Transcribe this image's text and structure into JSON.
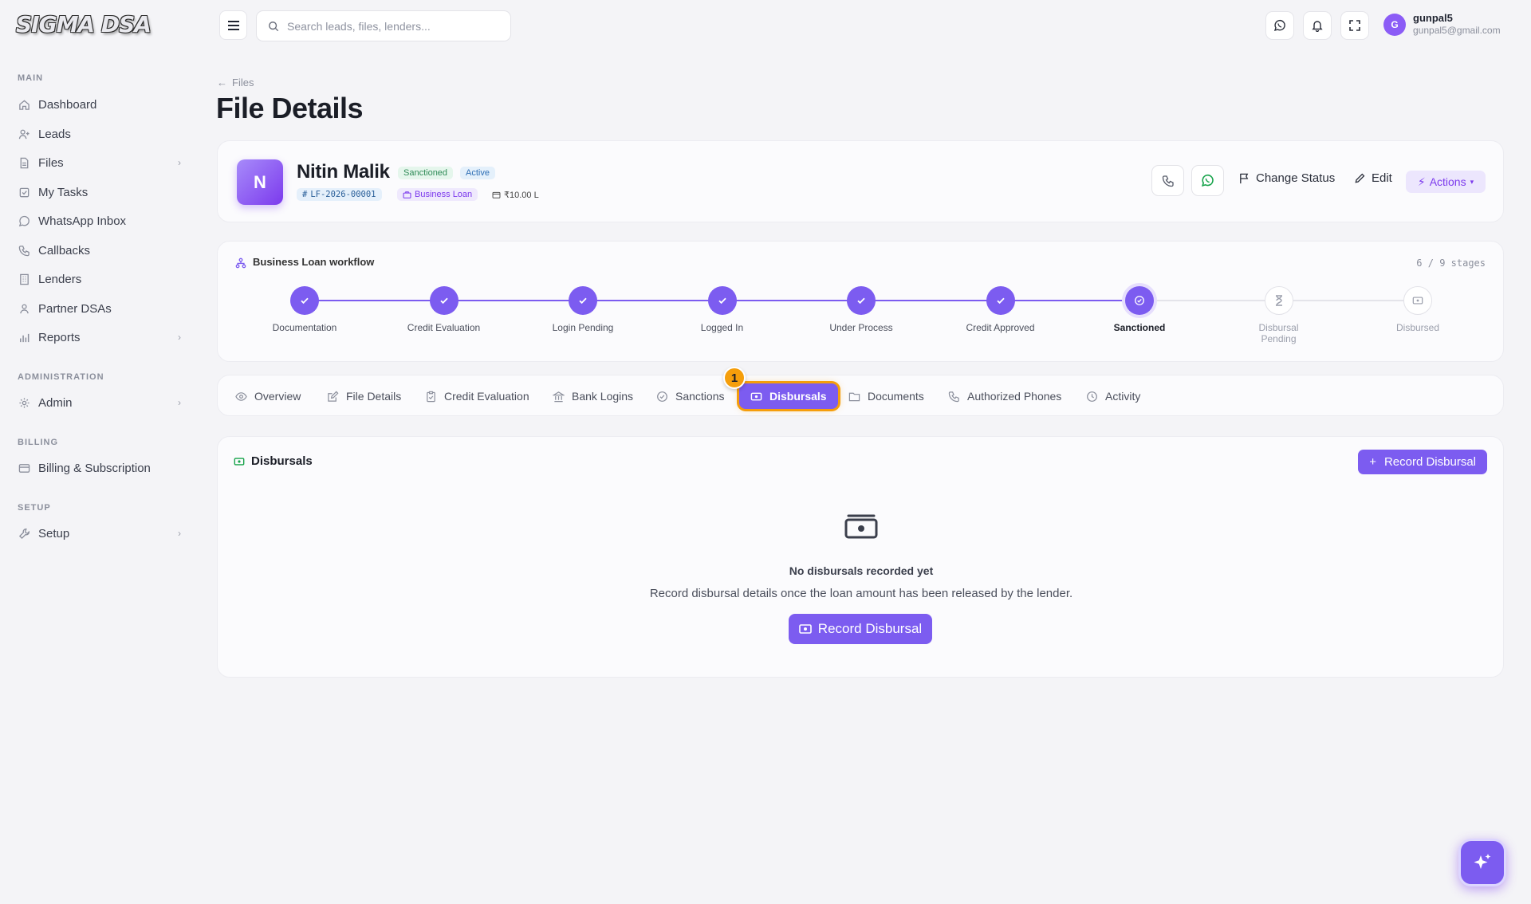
{
  "brand": {
    "logo_text": "SIGMA DSA",
    "accent": "#7c5cf0"
  },
  "sidebar": {
    "sections": {
      "main": "MAIN",
      "administration": "ADMINISTRATION",
      "billing": "BILLING",
      "setup": "SETUP"
    },
    "items": [
      {
        "label": "Dashboard",
        "icon": "home-icon"
      },
      {
        "label": "Leads",
        "icon": "user-plus-icon"
      },
      {
        "label": "Files",
        "icon": "file-icon",
        "has_children": true
      },
      {
        "label": "My Tasks",
        "icon": "checklist-icon"
      },
      {
        "label": "WhatsApp Inbox",
        "icon": "whatsapp-icon"
      },
      {
        "label": "Callbacks",
        "icon": "phone-icon"
      },
      {
        "label": "Lenders",
        "icon": "building-icon"
      },
      {
        "label": "Partner DSAs",
        "icon": "users-icon"
      },
      {
        "label": "Reports",
        "icon": "bar-chart-icon",
        "has_children": true
      },
      {
        "label": "Admin",
        "icon": "gear-icon",
        "has_children": true
      },
      {
        "label": "Billing & Subscription",
        "icon": "card-icon"
      },
      {
        "label": "Setup",
        "icon": "wrench-icon",
        "has_children": true
      }
    ]
  },
  "topbar": {
    "search_placeholder": "Search leads, files, lenders...",
    "user": {
      "initial": "G",
      "name": "gunpal5",
      "email": "gunpal5@gmail.com"
    }
  },
  "page": {
    "breadcrumb": "Files",
    "title": "File Details"
  },
  "lead": {
    "initial": "N",
    "name": "Nitin Malik",
    "status_badge": "Sanctioned",
    "state_badge": "Active",
    "file_id": "LF-2026-00001",
    "loan_type": "Business Loan",
    "amount": "₹10.00 L",
    "actions": {
      "change_status": "Change Status",
      "edit": "Edit",
      "actions": "Actions"
    }
  },
  "workflow": {
    "title": "Business Loan workflow",
    "progress": "6 / 9 stages",
    "completed_count": 6,
    "stages": [
      {
        "label": "Documentation",
        "state": "done"
      },
      {
        "label": "Credit Evaluation",
        "state": "done"
      },
      {
        "label": "Login Pending",
        "state": "done"
      },
      {
        "label": "Logged In",
        "state": "done"
      },
      {
        "label": "Under Process",
        "state": "done"
      },
      {
        "label": "Credit Approved",
        "state": "done"
      },
      {
        "label": "Sanctioned",
        "state": "current"
      },
      {
        "label": "Disbursal Pending",
        "state": "todo"
      },
      {
        "label": "Disbursed",
        "state": "todo"
      }
    ]
  },
  "tabs": [
    {
      "label": "Overview",
      "icon": "eye-icon"
    },
    {
      "label": "File Details",
      "icon": "edit-icon"
    },
    {
      "label": "Credit Evaluation",
      "icon": "clipboard-icon"
    },
    {
      "label": "Bank Logins",
      "icon": "bank-icon"
    },
    {
      "label": "Sanctions",
      "icon": "check-circle-icon"
    },
    {
      "label": "Disbursals",
      "icon": "cash-icon",
      "active": true
    },
    {
      "label": "Documents",
      "icon": "folder-icon"
    },
    {
      "label": "Authorized Phones",
      "icon": "phone-icon"
    },
    {
      "label": "Activity",
      "icon": "clock-icon"
    }
  ],
  "tab_badge": "1",
  "disbursals": {
    "title": "Disbursals",
    "record_button": "Record Disbursal",
    "empty_title": "No disbursals recorded yet",
    "empty_description": "Record disbursal details once the loan amount has been released by the lender.",
    "empty_button": "Record Disbursal"
  }
}
